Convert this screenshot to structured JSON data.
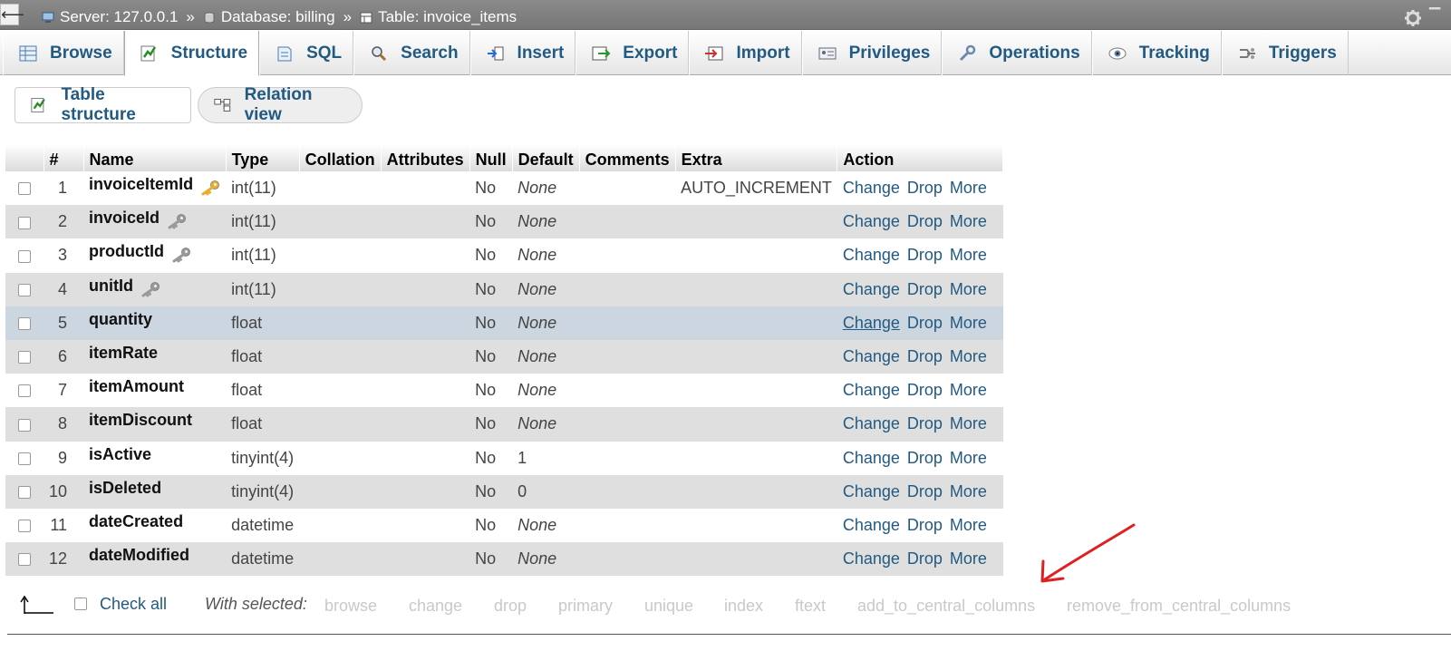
{
  "breadcrumb": {
    "back": "⟵",
    "server": "Server: 127.0.0.1",
    "database": "Database: billing",
    "table": "Table: invoice_items",
    "sep": "»"
  },
  "tabs": [
    {
      "label": "Browse",
      "icon": "browse-icon"
    },
    {
      "label": "Structure",
      "icon": "structure-icon",
      "active": true
    },
    {
      "label": "SQL",
      "icon": "sql-icon"
    },
    {
      "label": "Search",
      "icon": "search-icon"
    },
    {
      "label": "Insert",
      "icon": "insert-icon"
    },
    {
      "label": "Export",
      "icon": "export-icon"
    },
    {
      "label": "Import",
      "icon": "import-icon"
    },
    {
      "label": "Privileges",
      "icon": "privileges-icon"
    },
    {
      "label": "Operations",
      "icon": "operations-icon"
    },
    {
      "label": "Tracking",
      "icon": "tracking-icon"
    },
    {
      "label": "Triggers",
      "icon": "triggers-icon"
    }
  ],
  "subtabs": {
    "table_structure": "Table structure",
    "relation_view": "Relation view"
  },
  "columns": [
    "#",
    "Name",
    "Type",
    "Collation",
    "Attributes",
    "Null",
    "Default",
    "Comments",
    "Extra",
    "Action"
  ],
  "rows": [
    {
      "num": "1",
      "name": "invoiceItemId",
      "key": "primary",
      "type": "int(11)",
      "null": "No",
      "default": "None",
      "extra": "AUTO_INCREMENT"
    },
    {
      "num": "2",
      "name": "invoiceId",
      "key": "index",
      "type": "int(11)",
      "null": "No",
      "default": "None",
      "extra": ""
    },
    {
      "num": "3",
      "name": "productId",
      "key": "index",
      "type": "int(11)",
      "null": "No",
      "default": "None",
      "extra": ""
    },
    {
      "num": "4",
      "name": "unitId",
      "key": "index",
      "type": "int(11)",
      "null": "No",
      "default": "None",
      "extra": ""
    },
    {
      "num": "5",
      "name": "quantity",
      "key": "",
      "type": "float",
      "null": "No",
      "default": "None",
      "extra": ""
    },
    {
      "num": "6",
      "name": "itemRate",
      "key": "",
      "type": "float",
      "null": "No",
      "default": "None",
      "extra": ""
    },
    {
      "num": "7",
      "name": "itemAmount",
      "key": "",
      "type": "float",
      "null": "No",
      "default": "None",
      "extra": ""
    },
    {
      "num": "8",
      "name": "itemDiscount",
      "key": "",
      "type": "float",
      "null": "No",
      "default": "None",
      "extra": ""
    },
    {
      "num": "9",
      "name": "isActive",
      "key": "",
      "type": "tinyint(4)",
      "null": "No",
      "default": "1",
      "extra": ""
    },
    {
      "num": "10",
      "name": "isDeleted",
      "key": "",
      "type": "tinyint(4)",
      "null": "No",
      "default": "0",
      "extra": ""
    },
    {
      "num": "11",
      "name": "dateCreated",
      "key": "",
      "type": "datetime",
      "null": "No",
      "default": "None",
      "extra": ""
    },
    {
      "num": "12",
      "name": "dateModified",
      "key": "",
      "type": "datetime",
      "null": "No",
      "default": "None",
      "extra": ""
    }
  ],
  "actions": {
    "change": "Change",
    "drop": "Drop",
    "more": "More"
  },
  "footer": {
    "check_all": "Check all",
    "with_selected": "With selected:",
    "buttons": [
      "browse",
      "change",
      "drop",
      "primary",
      "unique",
      "index",
      "ftext",
      "add_to_central_columns",
      "remove_from_central_columns"
    ]
  },
  "colors": {
    "link": "#235a81",
    "annotation": "#e02020",
    "primary_key": "#e8b030",
    "index_key": "#9a9a9a"
  }
}
